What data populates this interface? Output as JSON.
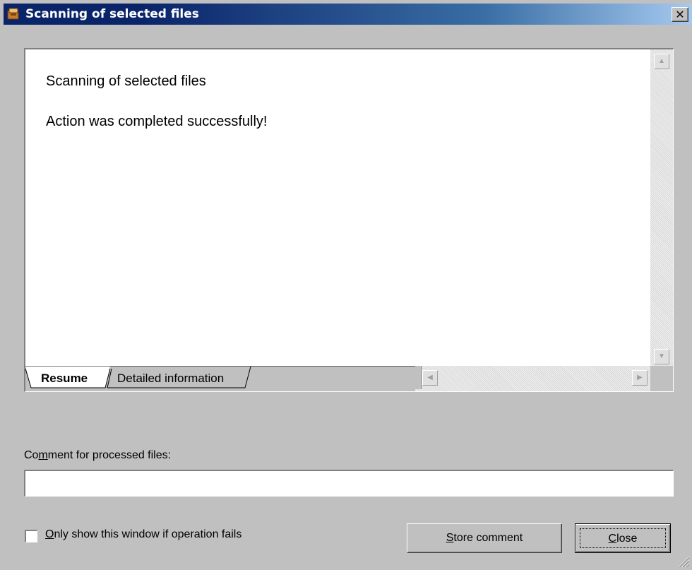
{
  "window": {
    "title": "Scanning of selected files",
    "close_glyph": "✕"
  },
  "report": {
    "heading": "Scanning of selected files",
    "message": "Action was completed successfully!"
  },
  "tabs": [
    {
      "label": "Resume",
      "active": true
    },
    {
      "label": "Detailed information",
      "active": false
    }
  ],
  "comment": {
    "label_before": "Co",
    "label_underlined": "m",
    "label_after": "ment for processed files:",
    "value": "",
    "placeholder": ""
  },
  "checkbox": {
    "label_underlined": "O",
    "label_after": "nly show this window if operation fails",
    "checked": false
  },
  "buttons": {
    "store_underlined": "S",
    "store_after": "tore comment",
    "close_underlined": "C",
    "close_after": "lose"
  },
  "icons": {
    "app": "app-icon",
    "close": "close-icon",
    "scroll_up": "scroll-up-arrow-icon",
    "scroll_down": "scroll-down-arrow-icon",
    "scroll_left": "scroll-left-arrow-icon",
    "scroll_right": "scroll-right-arrow-icon",
    "grip": "resize-grip-icon"
  },
  "colors": {
    "titlebar_start": "#0a246a",
    "titlebar_end": "#a6caf0",
    "face": "#c0c0c0"
  }
}
